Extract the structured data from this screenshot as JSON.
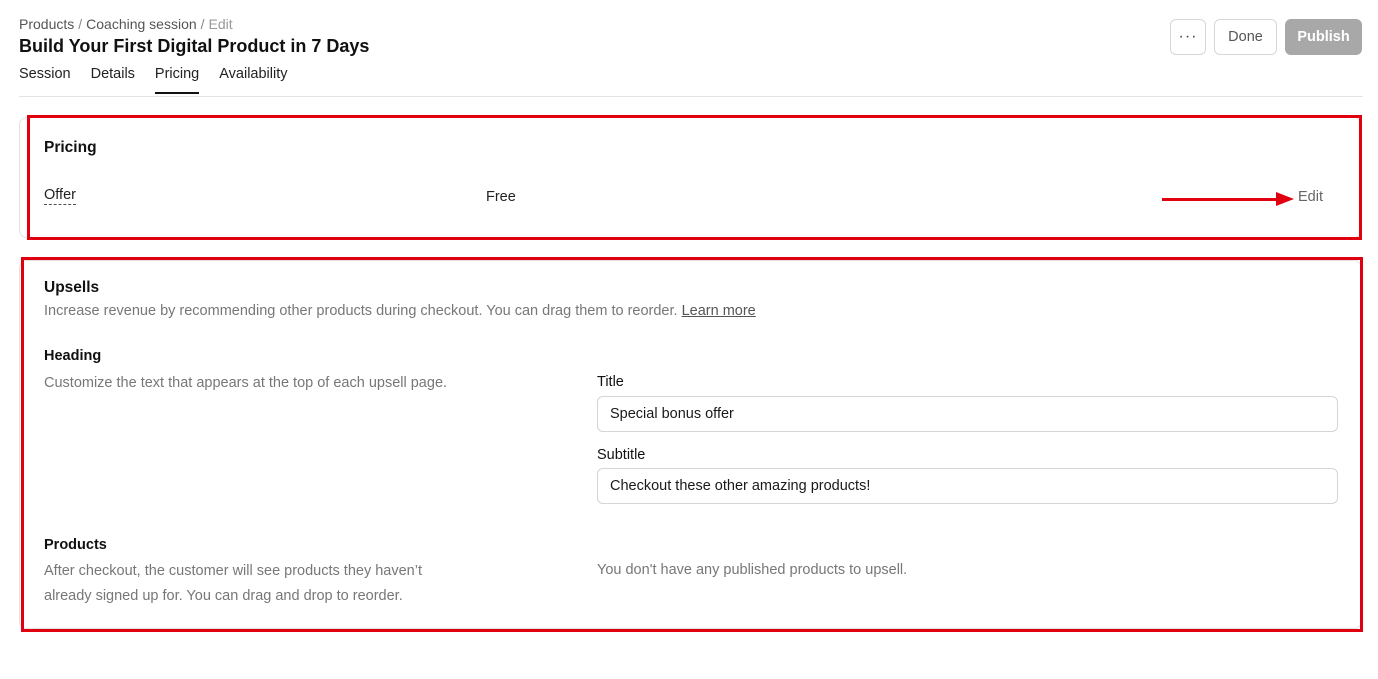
{
  "breadcrumb": {
    "items": [
      "Products",
      "Coaching session"
    ],
    "current": "Edit",
    "separator": "/"
  },
  "page": {
    "title": "Build Your First Digital Product in 7 Days"
  },
  "tabs": [
    {
      "label": "Session",
      "active": false
    },
    {
      "label": "Details",
      "active": false
    },
    {
      "label": "Pricing",
      "active": true
    },
    {
      "label": "Availability",
      "active": false
    }
  ],
  "actions": {
    "more_label": "···",
    "done_label": "Done",
    "publish_label": "Publish"
  },
  "pricing": {
    "title": "Pricing",
    "offer_label": "Offer",
    "offer_value": "Free",
    "edit_label": "Edit"
  },
  "upsells": {
    "title": "Upsells",
    "description": "Increase revenue by recommending other products during checkout. You can drag them to reorder.",
    "learn_more": "Learn more",
    "heading": {
      "label": "Heading",
      "description": "Customize the text that appears at the top of each upsell page.",
      "title_label": "Title",
      "title_value": "Special bonus offer",
      "subtitle_label": "Subtitle",
      "subtitle_value": "Checkout these other amazing products!"
    },
    "products": {
      "label": "Products",
      "description": "After checkout, the customer will see products they haven’t already signed up for. You can drag and drop to reorder.",
      "empty_note": "You don't have any published products to upsell."
    }
  },
  "colors": {
    "annotation": "#e00010",
    "publish_bg": "#a8a8a8",
    "muted_text": "#777777"
  }
}
